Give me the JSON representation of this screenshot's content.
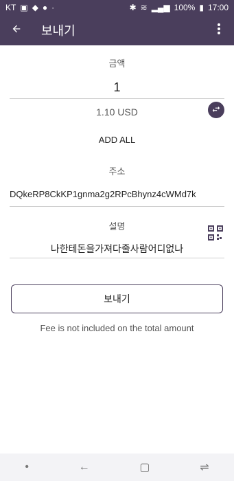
{
  "status_bar": {
    "carrier": "KT",
    "battery": "100%",
    "time": "17:00"
  },
  "app_bar": {
    "title": "보내기"
  },
  "form": {
    "amount_label": "금액",
    "amount_value": "1",
    "fiat_value": "1.10 USD",
    "add_all_label": "ADD ALL",
    "address_label": "주소",
    "address_value": "DQkeRP8CkKP1gnma2g2RPcBhynz4cWMd7k",
    "memo_label": "설명",
    "memo_value": "나한테돈을가져다줄사람어디없나"
  },
  "actions": {
    "send_label": "보내기",
    "fee_note": "Fee is not included on the total amount"
  },
  "colors": {
    "primary": "#4a3e5c",
    "divider": "#cfcfcf"
  },
  "icons": {
    "back": "arrow-left-icon",
    "menu": "kebab-menu-icon",
    "swap": "swap-arrows-icon",
    "qr": "qr-code-icon"
  }
}
